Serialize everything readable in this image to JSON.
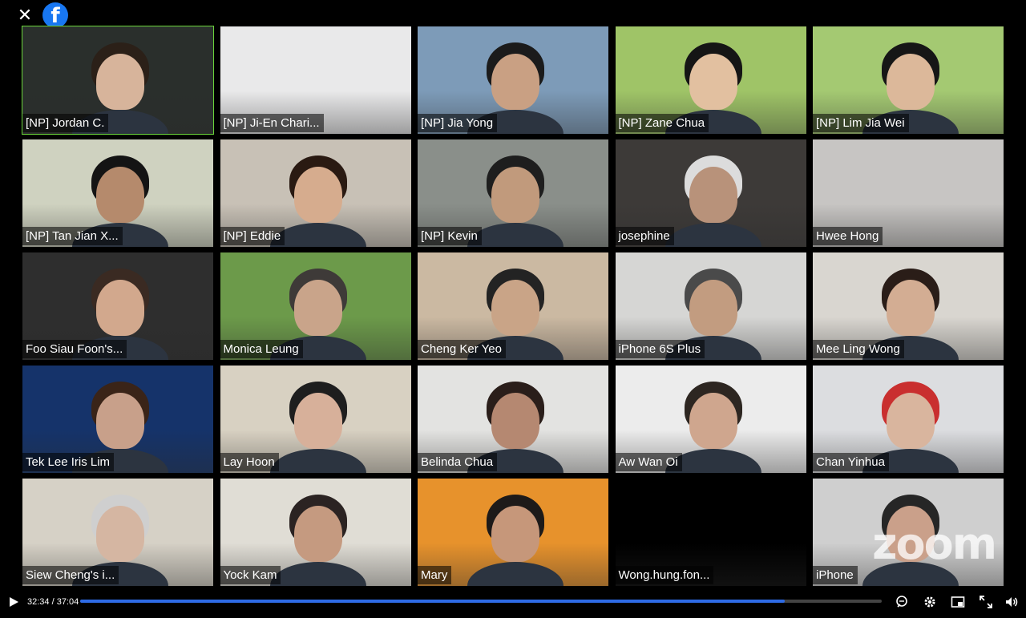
{
  "player": {
    "close_label": "✕",
    "brand_letter": "f",
    "watermark": "zoom",
    "current_time": "32:34",
    "duration": "37:04",
    "time_display": "32:34 / 37:04",
    "progress_fraction": 0.879,
    "accent_color": "#2e6be6",
    "active_speaker_color": "#6ad53a"
  },
  "participants": [
    {
      "name": "[NP] Jordan C.",
      "active": true,
      "bg": "#2a2f2c",
      "skin": "#d7b49b",
      "hair": "#2b2018"
    },
    {
      "name": "[NP] Ji-En Chari...",
      "bg": "#e9e9ea",
      "skin": null,
      "hair": null
    },
    {
      "name": "[NP] Jia Yong",
      "bg": "#7d9bb8",
      "skin": "#c9a083",
      "hair": "#1b1b1b"
    },
    {
      "name": "[NP] Zane Chua",
      "bg": "#9fc467",
      "skin": "#e2c0a0",
      "hair": "#151515"
    },
    {
      "name": "[NP] Lim Jia Wei",
      "bg": "#a4c972",
      "skin": "#dcb89a",
      "hair": "#161616"
    },
    {
      "name": "[NP] Tan Jian X...",
      "bg": "#cfd2c0",
      "skin": "#b58a6c",
      "hair": "#141414"
    },
    {
      "name": "[NP] Eddie",
      "bg": "#c8c1b6",
      "skin": "#d6ac8e",
      "hair": "#2a1a12"
    },
    {
      "name": "[NP] Kevin",
      "bg": "#8a8f8a",
      "skin": "#c19a7c",
      "hair": "#1e1e1e"
    },
    {
      "name": "josephine",
      "bg": "#3d3a38",
      "skin": "#b8927a",
      "hair": "#dcdcdc"
    },
    {
      "name": "Hwee Hong",
      "bg": "#c7c5c3",
      "skin": null,
      "hair": "#1a1a1a"
    },
    {
      "name": "Foo Siau Foon's...",
      "bg": "#2e2e2e",
      "skin": "#d2a88d",
      "hair": "#3a2a22"
    },
    {
      "name": "Monica Leung",
      "bg": "#6c9a4a",
      "skin": "#c9a48a",
      "hair": "#3e3a38"
    },
    {
      "name": "Cheng Ker Yeo",
      "bg": "#cbb9a2",
      "skin": "#c9a487",
      "hair": "#232323"
    },
    {
      "name": "iPhone 6S Plus",
      "bg": "#d6d6d4",
      "skin": "#c29c80",
      "hair": "#4a4a4a"
    },
    {
      "name": "Mee Ling Wong",
      "bg": "#d9d6d0",
      "skin": "#d3ad93",
      "hair": "#2a1d18"
    },
    {
      "name": "Tek Lee Iris Lim",
      "bg": "#15336a",
      "skin": "#c8a08a",
      "hair": "#3a2418"
    },
    {
      "name": "Lay Hoon",
      "bg": "#d8d1c2",
      "skin": "#d7b09a",
      "hair": "#1e1e1e"
    },
    {
      "name": "Belinda Chua",
      "bg": "#e3e3e1",
      "skin": "#b58871",
      "hair": "#2a1e1a"
    },
    {
      "name": "Aw Wan Oi",
      "bg": "#ececec",
      "skin": "#cfa68e",
      "hair": "#2d2621"
    },
    {
      "name": "Chan Yinhua",
      "bg": "#dcdde0",
      "skin": "#d9b59e",
      "hair": "#c92f2f"
    },
    {
      "name": "Siew Cheng's i...",
      "bg": "#d6d1c6",
      "skin": "#d5b6a2",
      "hair": "#cfcfcf"
    },
    {
      "name": "Yock Kam",
      "bg": "#e0ddd5",
      "skin": "#c59a80",
      "hair": "#2b2322"
    },
    {
      "name": "Mary",
      "bg": "#e7922c",
      "skin": "#c6977a",
      "hair": "#1d1a19"
    },
    {
      "name": "Wong.hung.fon...",
      "bg": "#000000",
      "skin": null,
      "hair": null
    },
    {
      "name": "iPhone",
      "bg": "#cfcfcf",
      "skin": "#caa08a",
      "hair": "#262626"
    }
  ],
  "icons": {
    "play": "play-icon",
    "captions": "captions-icon",
    "settings": "gear-icon",
    "miniplayer": "miniplayer-icon",
    "fullscreen": "fullscreen-icon",
    "volume": "volume-icon"
  }
}
